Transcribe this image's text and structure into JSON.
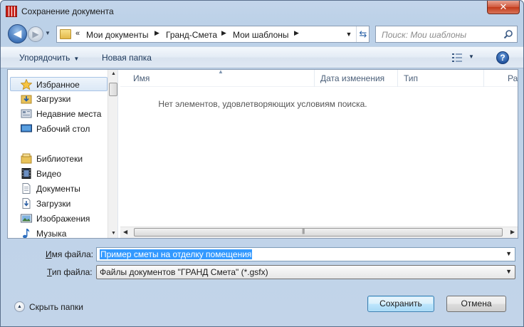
{
  "window": {
    "title": "Сохранение документа",
    "close_glyph": "✕"
  },
  "nav": {
    "back_glyph": "◀",
    "forward_glyph": "▶",
    "overflow_chevron": "«",
    "breadcrumbs": [
      "Мои документы",
      "Гранд-Смета",
      "Мои шаблоны"
    ],
    "search_placeholder": "Поиск: Мои шаблоны"
  },
  "toolbar": {
    "organize_label": "Упорядочить",
    "new_folder_label": "Новая папка",
    "help_glyph": "?"
  },
  "sidebar": {
    "favorites_label": "Избранное",
    "favorites": [
      "Загрузки",
      "Недавние места",
      "Рабочий стол"
    ],
    "libraries_label": "Библиотеки",
    "libraries": [
      "Видео",
      "Документы",
      "Загрузки",
      "Изображения",
      "Музыка"
    ]
  },
  "file_list": {
    "columns": [
      "Имя",
      "Дата изменения",
      "Тип",
      "Размер"
    ],
    "empty_message": "Нет элементов, удовлетворяющих условиям поиска."
  },
  "form": {
    "filename_label_accel": "И",
    "filename_label_rest": "мя файла:",
    "filename_value": "Пример сметы на отделку помещения",
    "filetype_label_accel": "Т",
    "filetype_label_rest": "ип файла:",
    "filetype_value": "Файлы документов \"ГРАНД Смета\" (*.gsfx)"
  },
  "footer": {
    "hide_folders_label": "Скрыть папки",
    "save_label": "Сохранить",
    "cancel_label": "Отмена"
  }
}
